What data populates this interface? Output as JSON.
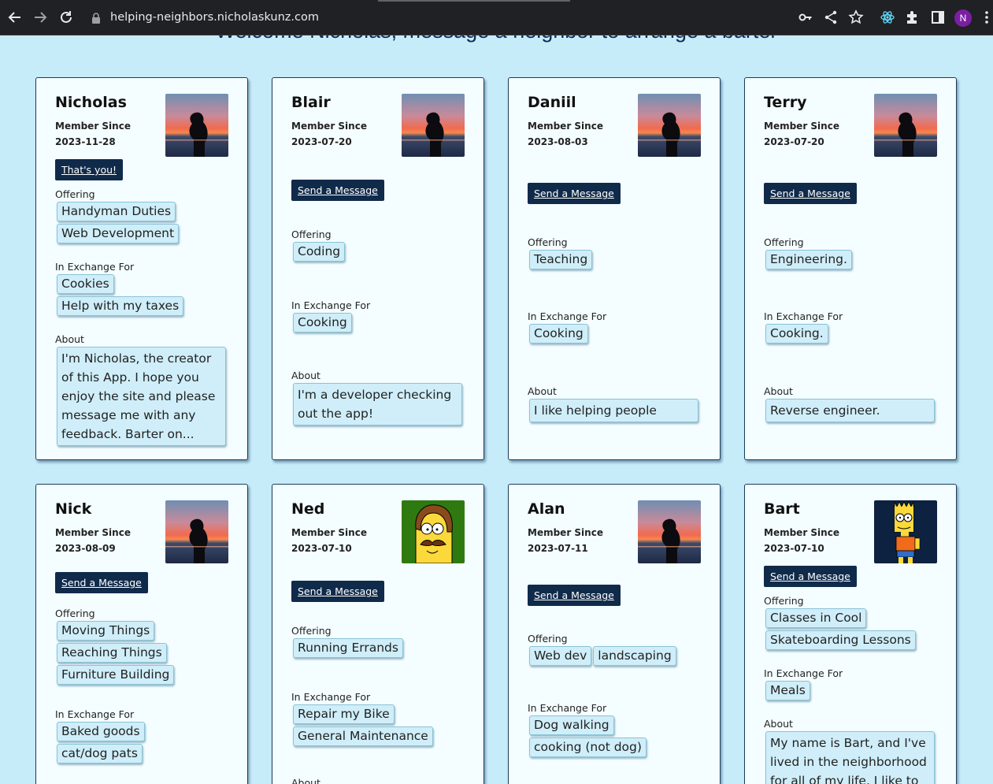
{
  "browser": {
    "url": "helping-neighbors.nicholaskunz.com",
    "profile_initial": "N",
    "icons": [
      "back-icon",
      "forward-icon",
      "reload-icon",
      "lock-icon",
      "key-icon",
      "share-icon",
      "star-icon",
      "react-devtools-icon",
      "extensions-icon",
      "side-panel-icon",
      "profile-avatar",
      "menu-icon"
    ]
  },
  "page": {
    "heading": "Welcome Nicholas, message a neighbor to arrange a barter"
  },
  "labels": {
    "member_since": "Member Since",
    "offering": "Offering",
    "exchange": "In Exchange For",
    "about": "About"
  },
  "cards": [
    {
      "name": "Nicholas",
      "date": "2023-11-28",
      "button": "That's you!",
      "offering": [
        "Handyman Duties",
        "Web Development"
      ],
      "exchange": [
        "Cookies",
        "Help with my taxes"
      ],
      "about": "I'm Nicholas, the creator of this App. I hope you enjoy the site and please message me with any feedback. Barter on...",
      "avatar": "sunset-silhouette"
    },
    {
      "name": "Blair",
      "date": "2023-07-20",
      "button": "Send a Message",
      "offering": [
        "Coding"
      ],
      "exchange": [
        "Cooking"
      ],
      "about": "I'm a developer checking out the app!",
      "avatar": "sunset-silhouette"
    },
    {
      "name": "Daniil",
      "date": "2023-08-03",
      "button": "Send a Message",
      "offering": [
        "Teaching"
      ],
      "exchange": [
        "Cooking"
      ],
      "about": "I like helping people",
      "avatar": "sunset-silhouette"
    },
    {
      "name": "Terry",
      "date": "2023-07-20",
      "button": "Send a Message",
      "offering": [
        "Engineering."
      ],
      "exchange": [
        "Cooking."
      ],
      "about": "Reverse engineer.",
      "avatar": "sunset-silhouette"
    },
    {
      "name": "Nick",
      "date": "2023-08-09",
      "button": "Send a Message",
      "offering": [
        "Moving Things",
        "Reaching Things",
        "Furniture Building"
      ],
      "exchange": [
        "Baked goods",
        "cat/dog pats"
      ],
      "about": "",
      "avatar": "sunset-silhouette"
    },
    {
      "name": "Ned",
      "date": "2023-07-10",
      "button": "Send a Message",
      "offering": [
        "Running Errands"
      ],
      "exchange": [
        "Repair my Bike",
        "General Maintenance"
      ],
      "about": "",
      "avatar": "ned-flanders-cartoon"
    },
    {
      "name": "Alan",
      "date": "2023-07-11",
      "button": "Send a Message",
      "offering": [
        "Web dev",
        "landscaping"
      ],
      "exchange": [
        "Dog walking",
        "cooking (not dog)"
      ],
      "about": "",
      "avatar": "sunset-silhouette"
    },
    {
      "name": "Bart",
      "date": "2023-07-10",
      "button": "Send a Message",
      "offering": [
        "Classes in Cool",
        "Skateboarding Lessons"
      ],
      "exchange": [
        "Meals"
      ],
      "about": "My name is Bart, and I've lived in the neighborhood for all of my life. I like to",
      "avatar": "bart-simpson-cartoon"
    }
  ]
}
